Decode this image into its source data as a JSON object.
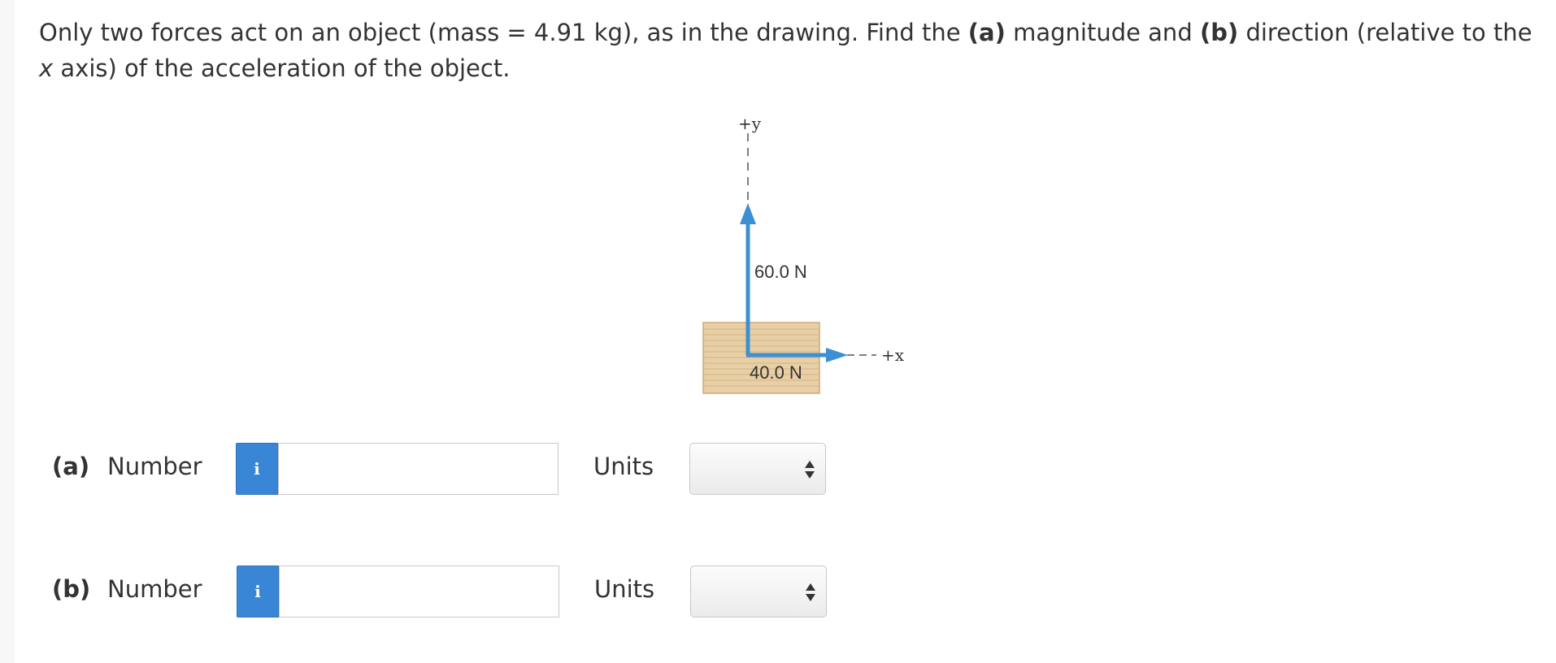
{
  "question": {
    "pre_mass": "Only two forces act on an object (mass = 4.91 kg), as in the drawing. Find the ",
    "a_tag": "(a)",
    "mid1": " magnitude and ",
    "b_tag": "(b)",
    "mid2": " direction (relative to the ",
    "x_var": "x",
    "post": " axis) of the acceleration of the object."
  },
  "diagram": {
    "y_axis_label": "+y",
    "x_axis_label": "+x",
    "vertical_force_label": "60.0 N",
    "horizontal_force_label": "40.0 N",
    "arrow_color": "#3c8fd2",
    "block_color": "#e9cfa6"
  },
  "parts": [
    {
      "tag": "(a)",
      "number_label": "Number",
      "info_icon": "i",
      "input_value": "",
      "units_label": "Units",
      "units_selected": ""
    },
    {
      "tag": "(b)",
      "number_label": "Number",
      "info_icon": "i",
      "input_value": "",
      "units_label": "Units",
      "units_selected": ""
    }
  ]
}
